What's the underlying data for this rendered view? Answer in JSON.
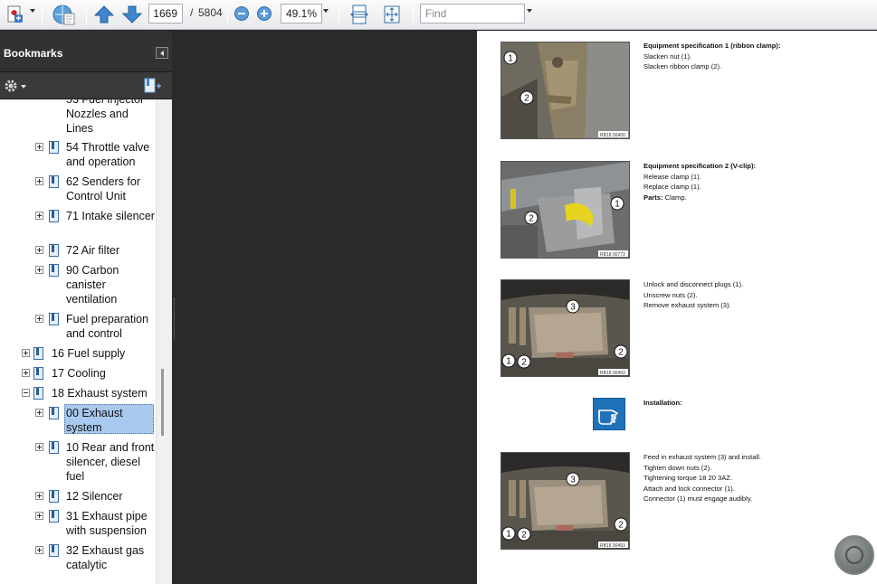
{
  "toolbar": {
    "page_current": "1669",
    "page_separator": "/",
    "page_total": "5804",
    "zoom": "49.1%",
    "find_placeholder": "Find",
    "icons": [
      "create-pdf-icon",
      "share-icon",
      "previous-page-icon",
      "next-page-icon",
      "zoom-out-icon",
      "zoom-in-icon",
      "fit-width-icon",
      "full-screen-icon"
    ]
  },
  "sidebar": {
    "title": "Bookmarks",
    "items": [
      {
        "label": "53 Fuel Injector Nozzles and Lines",
        "level": 2,
        "expander": "none"
      },
      {
        "label": "54 Throttle valve and operation",
        "level": 2,
        "expander": "plus"
      },
      {
        "label": "62 Senders for Control Unit",
        "level": 2,
        "expander": "plus"
      },
      {
        "label": "71 Intake silencer",
        "level": 2,
        "expander": "plus"
      },
      {
        "label": "72 Air filter",
        "level": 2,
        "expander": "plus"
      },
      {
        "label": "90 Carbon canister ventilation",
        "level": 2,
        "expander": "plus"
      },
      {
        "label": "Fuel preparation and control",
        "level": 2,
        "expander": "plus"
      },
      {
        "label": "16 Fuel supply",
        "level": 1,
        "expander": "plus"
      },
      {
        "label": "17 Cooling",
        "level": 1,
        "expander": "plus"
      },
      {
        "label": "18 Exhaust system",
        "level": 1,
        "expander": "minus"
      },
      {
        "label": "00 Exhaust system",
        "level": 2,
        "expander": "plus",
        "selected": true
      },
      {
        "label": "10 Rear and front silencer, diesel fuel",
        "level": 2,
        "expander": "plus"
      },
      {
        "label": "12 Silencer",
        "level": 2,
        "expander": "plus"
      },
      {
        "label": "31 Exhaust pipe with suspension",
        "level": 2,
        "expander": "plus"
      },
      {
        "label": "32 Exhaust gas catalytic converter",
        "level": 2,
        "expander": "plus"
      }
    ]
  },
  "document": {
    "steps": [
      {
        "photo_code": "RB18 00400",
        "callouts": [
          "1",
          "2"
        ],
        "lines": [
          {
            "bold": "Equipment specification 1 (ribbon clamp):",
            "text": ""
          },
          {
            "bold": "",
            "text": "Slacken nut (1)."
          },
          {
            "bold": "",
            "text": "Slacken ribbon clamp (2)."
          }
        ]
      },
      {
        "photo_code": "RB18 00773",
        "callouts": [
          "1",
          "2"
        ],
        "lines": [
          {
            "bold": "Equipment specification 2 (V-clip):",
            "text": ""
          },
          {
            "bold": "",
            "text": "Release clamp (1)."
          },
          {
            "bold": "",
            "text": "Replace clamp (1)."
          },
          {
            "bold": "Parts:",
            "text": " Clamp."
          }
        ]
      },
      {
        "photo_code": "RB18 00493",
        "callouts": [
          "3",
          "1",
          "2",
          "2"
        ],
        "lines": [
          {
            "bold": "",
            "text": "Unlock and disconnect plugs (1)."
          },
          {
            "bold": "",
            "text": "Unscrew nuts (2)."
          },
          {
            "bold": "",
            "text": "Remove exhaust system (3)."
          }
        ]
      },
      {
        "photo_code": "",
        "callouts": [],
        "icon": "installation-hand-icon",
        "lines": [
          {
            "bold": "Installation:",
            "text": ""
          }
        ]
      },
      {
        "photo_code": "RB18 00493",
        "callouts": [
          "3",
          "1",
          "2",
          "2"
        ],
        "lines": [
          {
            "bold": "",
            "text": "Feed in exhaust system (3) and install."
          },
          {
            "bold": "",
            "text": "Tighten down nuts (2)."
          },
          {
            "bold": "",
            "text": "Tightening torque 18 20 3AZ."
          },
          {
            "bold": "",
            "text": "Attach and lock connector (1)."
          },
          {
            "bold": "",
            "text": "Connector (1) must engage audibly."
          }
        ]
      }
    ]
  }
}
